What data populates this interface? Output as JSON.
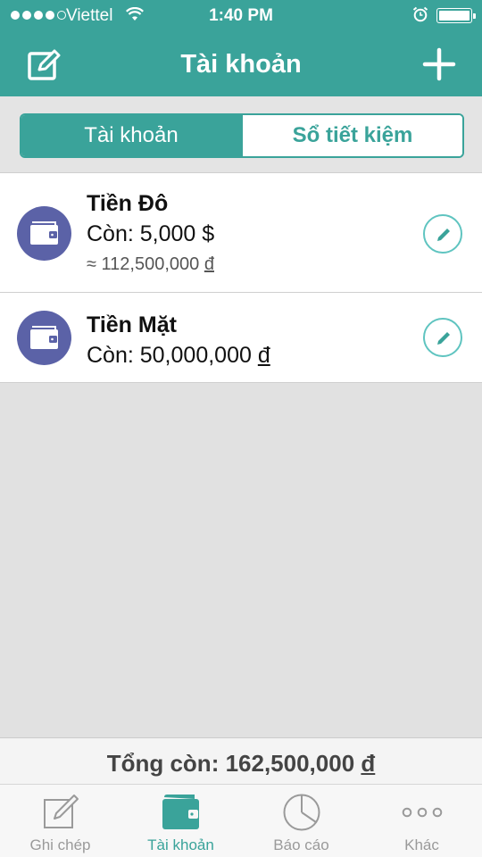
{
  "status_bar": {
    "carrier": "Viettel",
    "time": "1:40 PM"
  },
  "header": {
    "title": "Tài khoản"
  },
  "segments": {
    "accounts": "Tài khoản",
    "savings": "Sổ tiết kiệm",
    "active": "accounts"
  },
  "accounts": [
    {
      "name": "Tiền Đô",
      "balance_prefix": "Còn: 5,000 $",
      "approx_prefix": "≈ 112,500,000 ",
      "approx_currency": "đ"
    },
    {
      "name": "Tiền Mặt",
      "balance_prefix": "Còn: 50,000,000 ",
      "balance_currency": "đ"
    }
  ],
  "total": {
    "prefix": "Tổng còn: 162,500,000 ",
    "currency": "đ"
  },
  "tabs": [
    {
      "label": "Ghi chép",
      "icon": "note-edit-icon"
    },
    {
      "label": "Tài khoản",
      "icon": "wallet-icon"
    },
    {
      "label": "Báo cáo",
      "icon": "pie-chart-icon"
    },
    {
      "label": "Khác",
      "icon": "more-dots-icon"
    }
  ],
  "colors": {
    "accent": "#3aa39a",
    "avatar": "#5b62a7",
    "background": "#e1e1e1"
  }
}
